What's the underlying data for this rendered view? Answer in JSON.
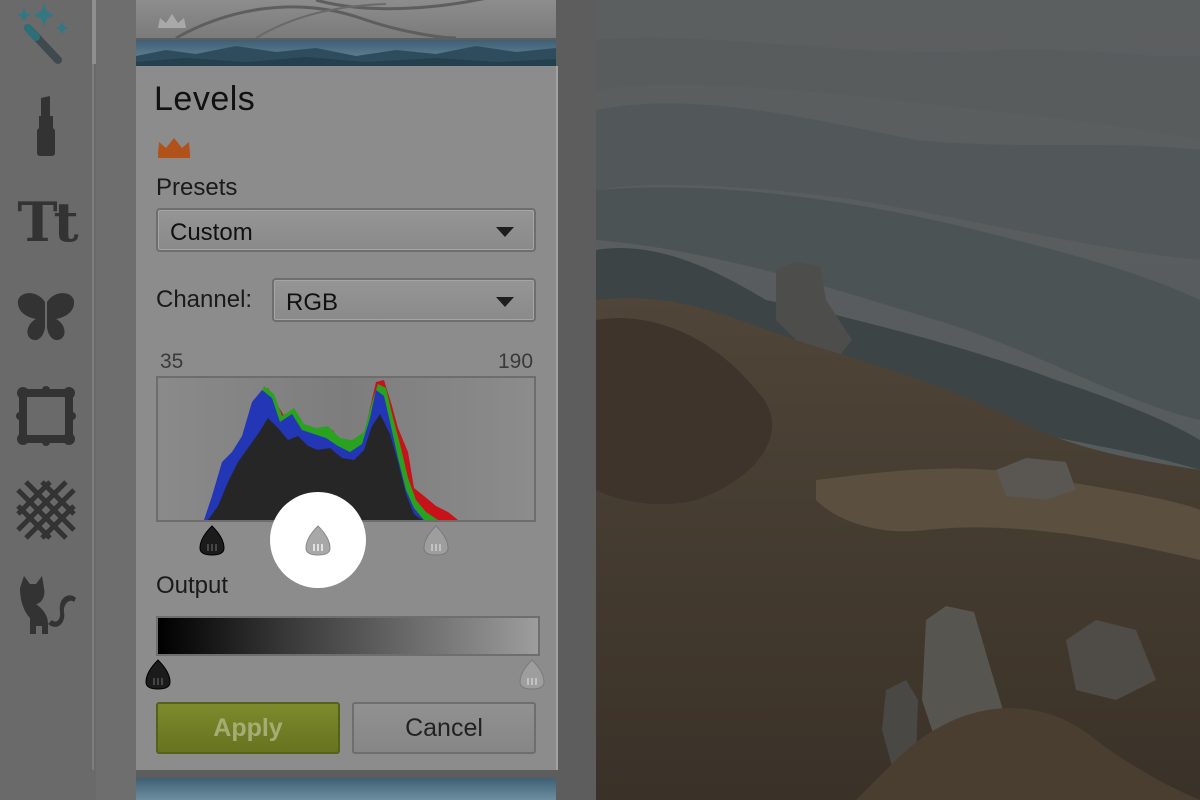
{
  "rail": {
    "icons": [
      "magic-wand-icon",
      "lipstick-icon",
      "text-icon",
      "butterfly-icon",
      "frame-icon",
      "texture-icon",
      "cat-icon"
    ],
    "text_glyph": "Tt"
  },
  "panel": {
    "title": "Levels",
    "presets_label": "Presets",
    "presets_value": "Custom",
    "channel_label": "Channel:",
    "channel_value": "RGB",
    "input_black": "35",
    "input_white": "190",
    "output_label": "Output",
    "apply_label": "Apply",
    "cancel_label": "Cancel"
  },
  "colors": {
    "apply_green": "#6f7b24",
    "crown_orange": "#b0521a"
  }
}
